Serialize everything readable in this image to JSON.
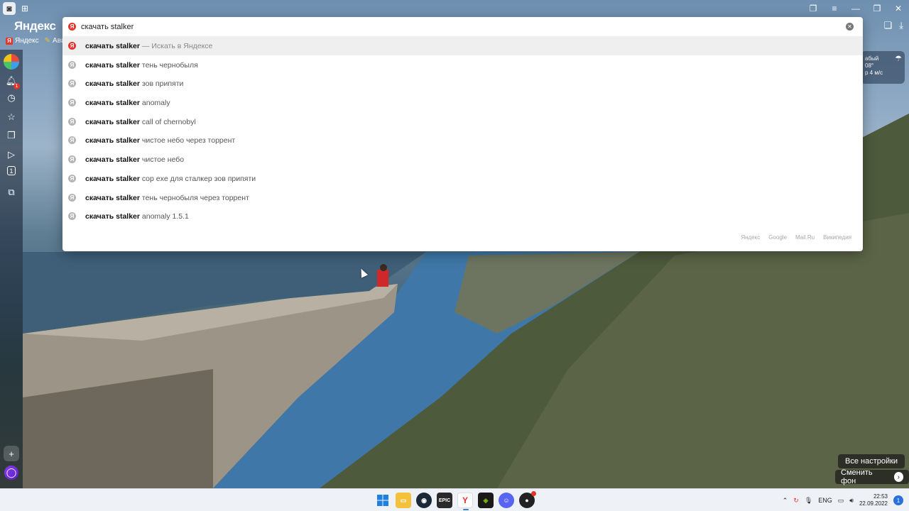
{
  "browser": {
    "logo": "Яндекс",
    "bookmarks": [
      {
        "label": "Яндекс",
        "icon": "yandex-icon"
      },
      {
        "label": "Ави",
        "icon": "avito-icon"
      }
    ]
  },
  "search": {
    "query": "скачать stalker",
    "suggestions": [
      {
        "bold": "скачать stalker",
        "rest": " — Искать в Яндексе"
      },
      {
        "bold": "скачать stalker",
        "rest": " тень чернобыля"
      },
      {
        "bold": "скачать stalker",
        "rest": " зов припяти"
      },
      {
        "bold": "скачать stalker",
        "rest": " anomaly"
      },
      {
        "bold": "скачать stalker",
        "rest": " call of chernobyl"
      },
      {
        "bold": "скачать stalker",
        "rest": " чистое небо через торрент"
      },
      {
        "bold": "скачать stalker",
        "rest": " чистое небо"
      },
      {
        "bold": "скачать stalker",
        "rest": " cop exe для сталкер зов припяти"
      },
      {
        "bold": "скачать stalker",
        "rest": " тень чернобыля через торрент"
      },
      {
        "bold": "скачать stalker",
        "rest": " anomaly 1.5.1"
      }
    ],
    "engines": [
      "Яндекс",
      "Google",
      "Mail.Ru",
      "Википедия"
    ]
  },
  "sidebar": {
    "notification_count": "1",
    "tab_count": "1"
  },
  "weather": {
    "line1": "абый",
    "line2": "08°",
    "line3": "р 4 м/с"
  },
  "newtab": {
    "settings_label": "Все настройки",
    "change_bg_label": "Сменить фон"
  },
  "taskbar": {
    "epic_label": "EPIC",
    "yandex_label": "Y",
    "tray_lang": "ENG",
    "time": "22:53",
    "date": "22.09.2022",
    "notif_count": "1"
  },
  "colors": {
    "yandex_red": "#e8322c",
    "accent_blue": "#2a6fdb"
  }
}
